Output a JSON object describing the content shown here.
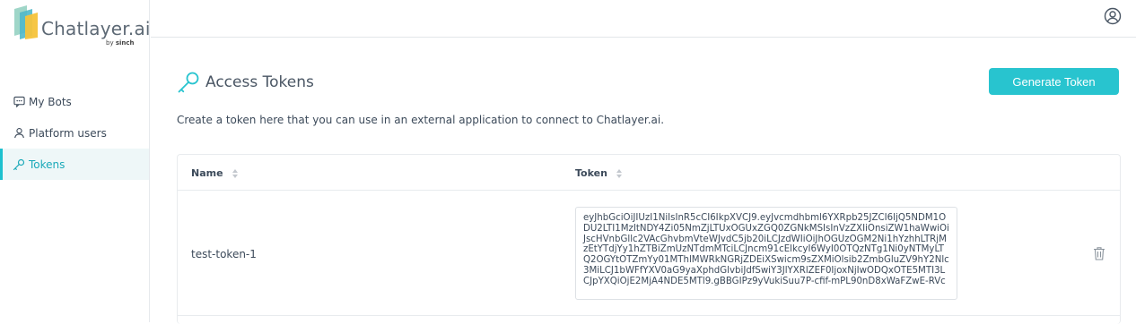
{
  "brand": {
    "name": "Chatlayer",
    "suffix": ".ai",
    "by": "by",
    "by_brand": "sinch"
  },
  "sidebar": {
    "items": [
      {
        "label": "My Bots",
        "icon": "chat-bubble-icon",
        "active": false
      },
      {
        "label": "Platform users",
        "icon": "user-icon",
        "active": false
      },
      {
        "label": "Tokens",
        "icon": "key-icon",
        "active": true
      }
    ]
  },
  "header": {
    "account_icon": "account-circle-icon"
  },
  "page": {
    "title": "Access Tokens",
    "generate_label": "Generate Token",
    "description": "Create a token here that you can use in an external application to connect to Chatlayer.ai."
  },
  "table": {
    "columns": [
      "Name",
      "Token"
    ],
    "rows": [
      {
        "name": "test-token-1",
        "token": "eyJhbGciOiJIUzI1NiIsInR5cCI6IkpXVCJ9.eyJvcmdhbml6YXRpb25JZCI6IjQ5NDM1ODU2LTI1MzItNDY4Zi05NmZjLTUxOGUxZGQ0ZGNkMSIsInVzZXIiOnsiZW1haWwiOiJscHVnbGllc2VAcGhvbmVteWJvdC5jb20iLCJzdWIiOiJhOGUzOGM2Ni1hYzhhLTRjMzEtYTdjYy1hZTBiZmUzNTdmMTciLCJncm91cElkcyI6WyI0OTQzNTg1Ni0yNTMyLTQ2OGYtOTZmYy01MThlMWRkNGRjZDEiXSwicm9sZXMiOlsib2ZmbGluZV9hY2Nlc3MiLCJ1bWFfYXV0aG9yaXphdGlvbiJdfSwiY3JlYXRlZEF0IjoxNjIwODQxOTE5MTI3LCJpYXQiOjE2MjA4NDE5MTl9.gBBGIPz9yVukiSuu7P-cfif-mPL90nD8xWaFZwE-RVc"
      }
    ]
  }
}
